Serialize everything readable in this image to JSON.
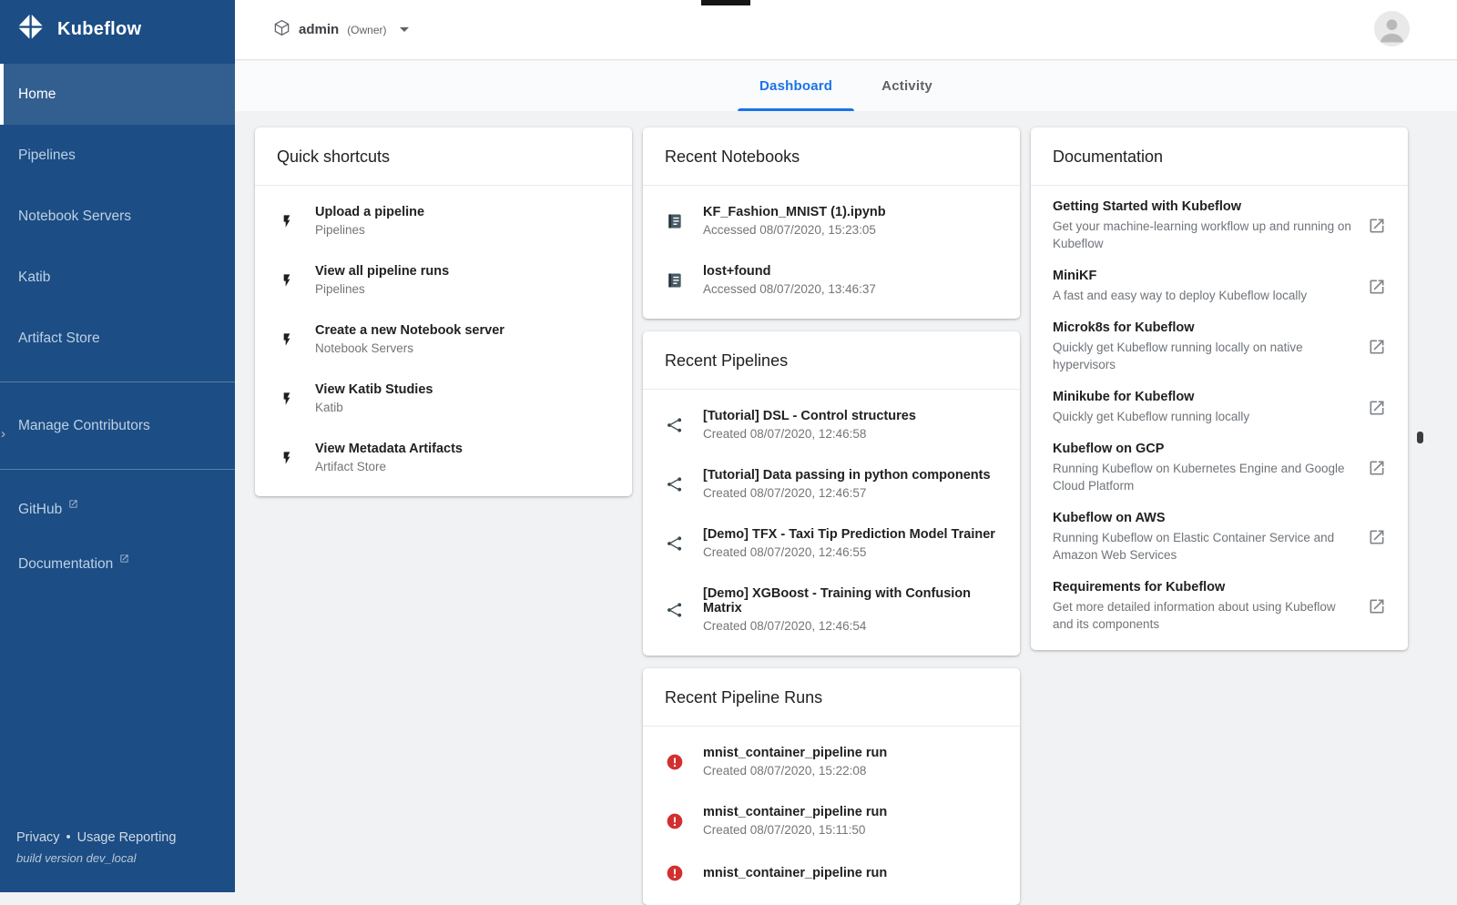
{
  "colors": {
    "accent": "#1a73e8",
    "sidebar_bg": "#1c4d84",
    "error": "#d32f2f",
    "content_bg": "#f1f2f3"
  },
  "sidebar": {
    "brand": "Kubeflow",
    "logo_icon": "kubeflow-logo-icon",
    "items": [
      {
        "label": "Home",
        "active": true
      },
      {
        "label": "Pipelines",
        "active": false
      },
      {
        "label": "Notebook Servers",
        "active": false
      },
      {
        "label": "Katib",
        "active": false
      },
      {
        "label": "Artifact Store",
        "active": false
      }
    ],
    "secondary_items": [
      {
        "label": "Manage Contributors",
        "active": false
      }
    ],
    "external_links": [
      {
        "label": "GitHub",
        "icon": "open-in-new-icon"
      },
      {
        "label": "Documentation",
        "icon": "open-in-new-icon"
      }
    ],
    "footer": {
      "privacy_label": "Privacy",
      "separator": "•",
      "usage_label": "Usage Reporting",
      "build_version": "build version dev_local"
    }
  },
  "topbar": {
    "namespace_icon": "namespace-cube-icon",
    "namespace": "admin",
    "namespace_role": "(Owner)",
    "caret_icon": "caret-down-icon",
    "avatar_icon": "avatar-icon"
  },
  "tabs": [
    {
      "label": "Dashboard",
      "active": true
    },
    {
      "label": "Activity",
      "active": false
    }
  ],
  "cards": {
    "quick_shortcuts": {
      "title": "Quick shortcuts",
      "item_icon": "bolt-icon",
      "items": [
        {
          "title": "Upload a pipeline",
          "subtitle": "Pipelines"
        },
        {
          "title": "View all pipeline runs",
          "subtitle": "Pipelines"
        },
        {
          "title": "Create a new Notebook server",
          "subtitle": "Notebook Servers"
        },
        {
          "title": "View Katib Studies",
          "subtitle": "Katib"
        },
        {
          "title": "View Metadata Artifacts",
          "subtitle": "Artifact Store"
        }
      ]
    },
    "recent_notebooks": {
      "title": "Recent Notebooks",
      "item_icon": "notebook-icon",
      "items": [
        {
          "title": "KF_Fashion_MNIST (1).ipynb",
          "subtitle": "Accessed 08/07/2020, 15:23:05"
        },
        {
          "title": "lost+found",
          "subtitle": "Accessed 08/07/2020, 13:46:37"
        }
      ]
    },
    "recent_pipelines": {
      "title": "Recent Pipelines",
      "item_icon": "pipeline-icon",
      "items": [
        {
          "title": "[Tutorial] DSL - Control structures",
          "subtitle": "Created 08/07/2020, 12:46:58"
        },
        {
          "title": "[Tutorial] Data passing in python components",
          "subtitle": "Created 08/07/2020, 12:46:57"
        },
        {
          "title": "[Demo] TFX - Taxi Tip Prediction Model Trainer",
          "subtitle": "Created 08/07/2020, 12:46:55"
        },
        {
          "title": "[Demo] XGBoost - Training with Confusion Matrix",
          "subtitle": "Created 08/07/2020, 12:46:54"
        }
      ]
    },
    "recent_pipeline_runs": {
      "title": "Recent Pipeline Runs",
      "item_icon": "error-icon",
      "items": [
        {
          "title": "mnist_container_pipeline run",
          "subtitle": "Created 08/07/2020, 15:22:08"
        },
        {
          "title": "mnist_container_pipeline run",
          "subtitle": "Created 08/07/2020, 15:11:50"
        },
        {
          "title": "mnist_container_pipeline run",
          "subtitle": ""
        }
      ]
    },
    "documentation": {
      "title": "Documentation",
      "item_icon": "open-in-new-icon",
      "items": [
        {
          "title": "Getting Started with Kubeflow",
          "desc": "Get your machine-learning workflow up and running on Kubeflow"
        },
        {
          "title": "MiniKF",
          "desc": "A fast and easy way to deploy Kubeflow locally"
        },
        {
          "title": "Microk8s for Kubeflow",
          "desc": "Quickly get Kubeflow running locally on native hypervisors"
        },
        {
          "title": "Minikube for Kubeflow",
          "desc": "Quickly get Kubeflow running locally"
        },
        {
          "title": "Kubeflow on GCP",
          "desc": "Running Kubeflow on Kubernetes Engine and Google Cloud Platform"
        },
        {
          "title": "Kubeflow on AWS",
          "desc": "Running Kubeflow on Elastic Container Service and Amazon Web Services"
        },
        {
          "title": "Requirements for Kubeflow",
          "desc": "Get more detailed information about using Kubeflow and its components"
        }
      ]
    }
  }
}
